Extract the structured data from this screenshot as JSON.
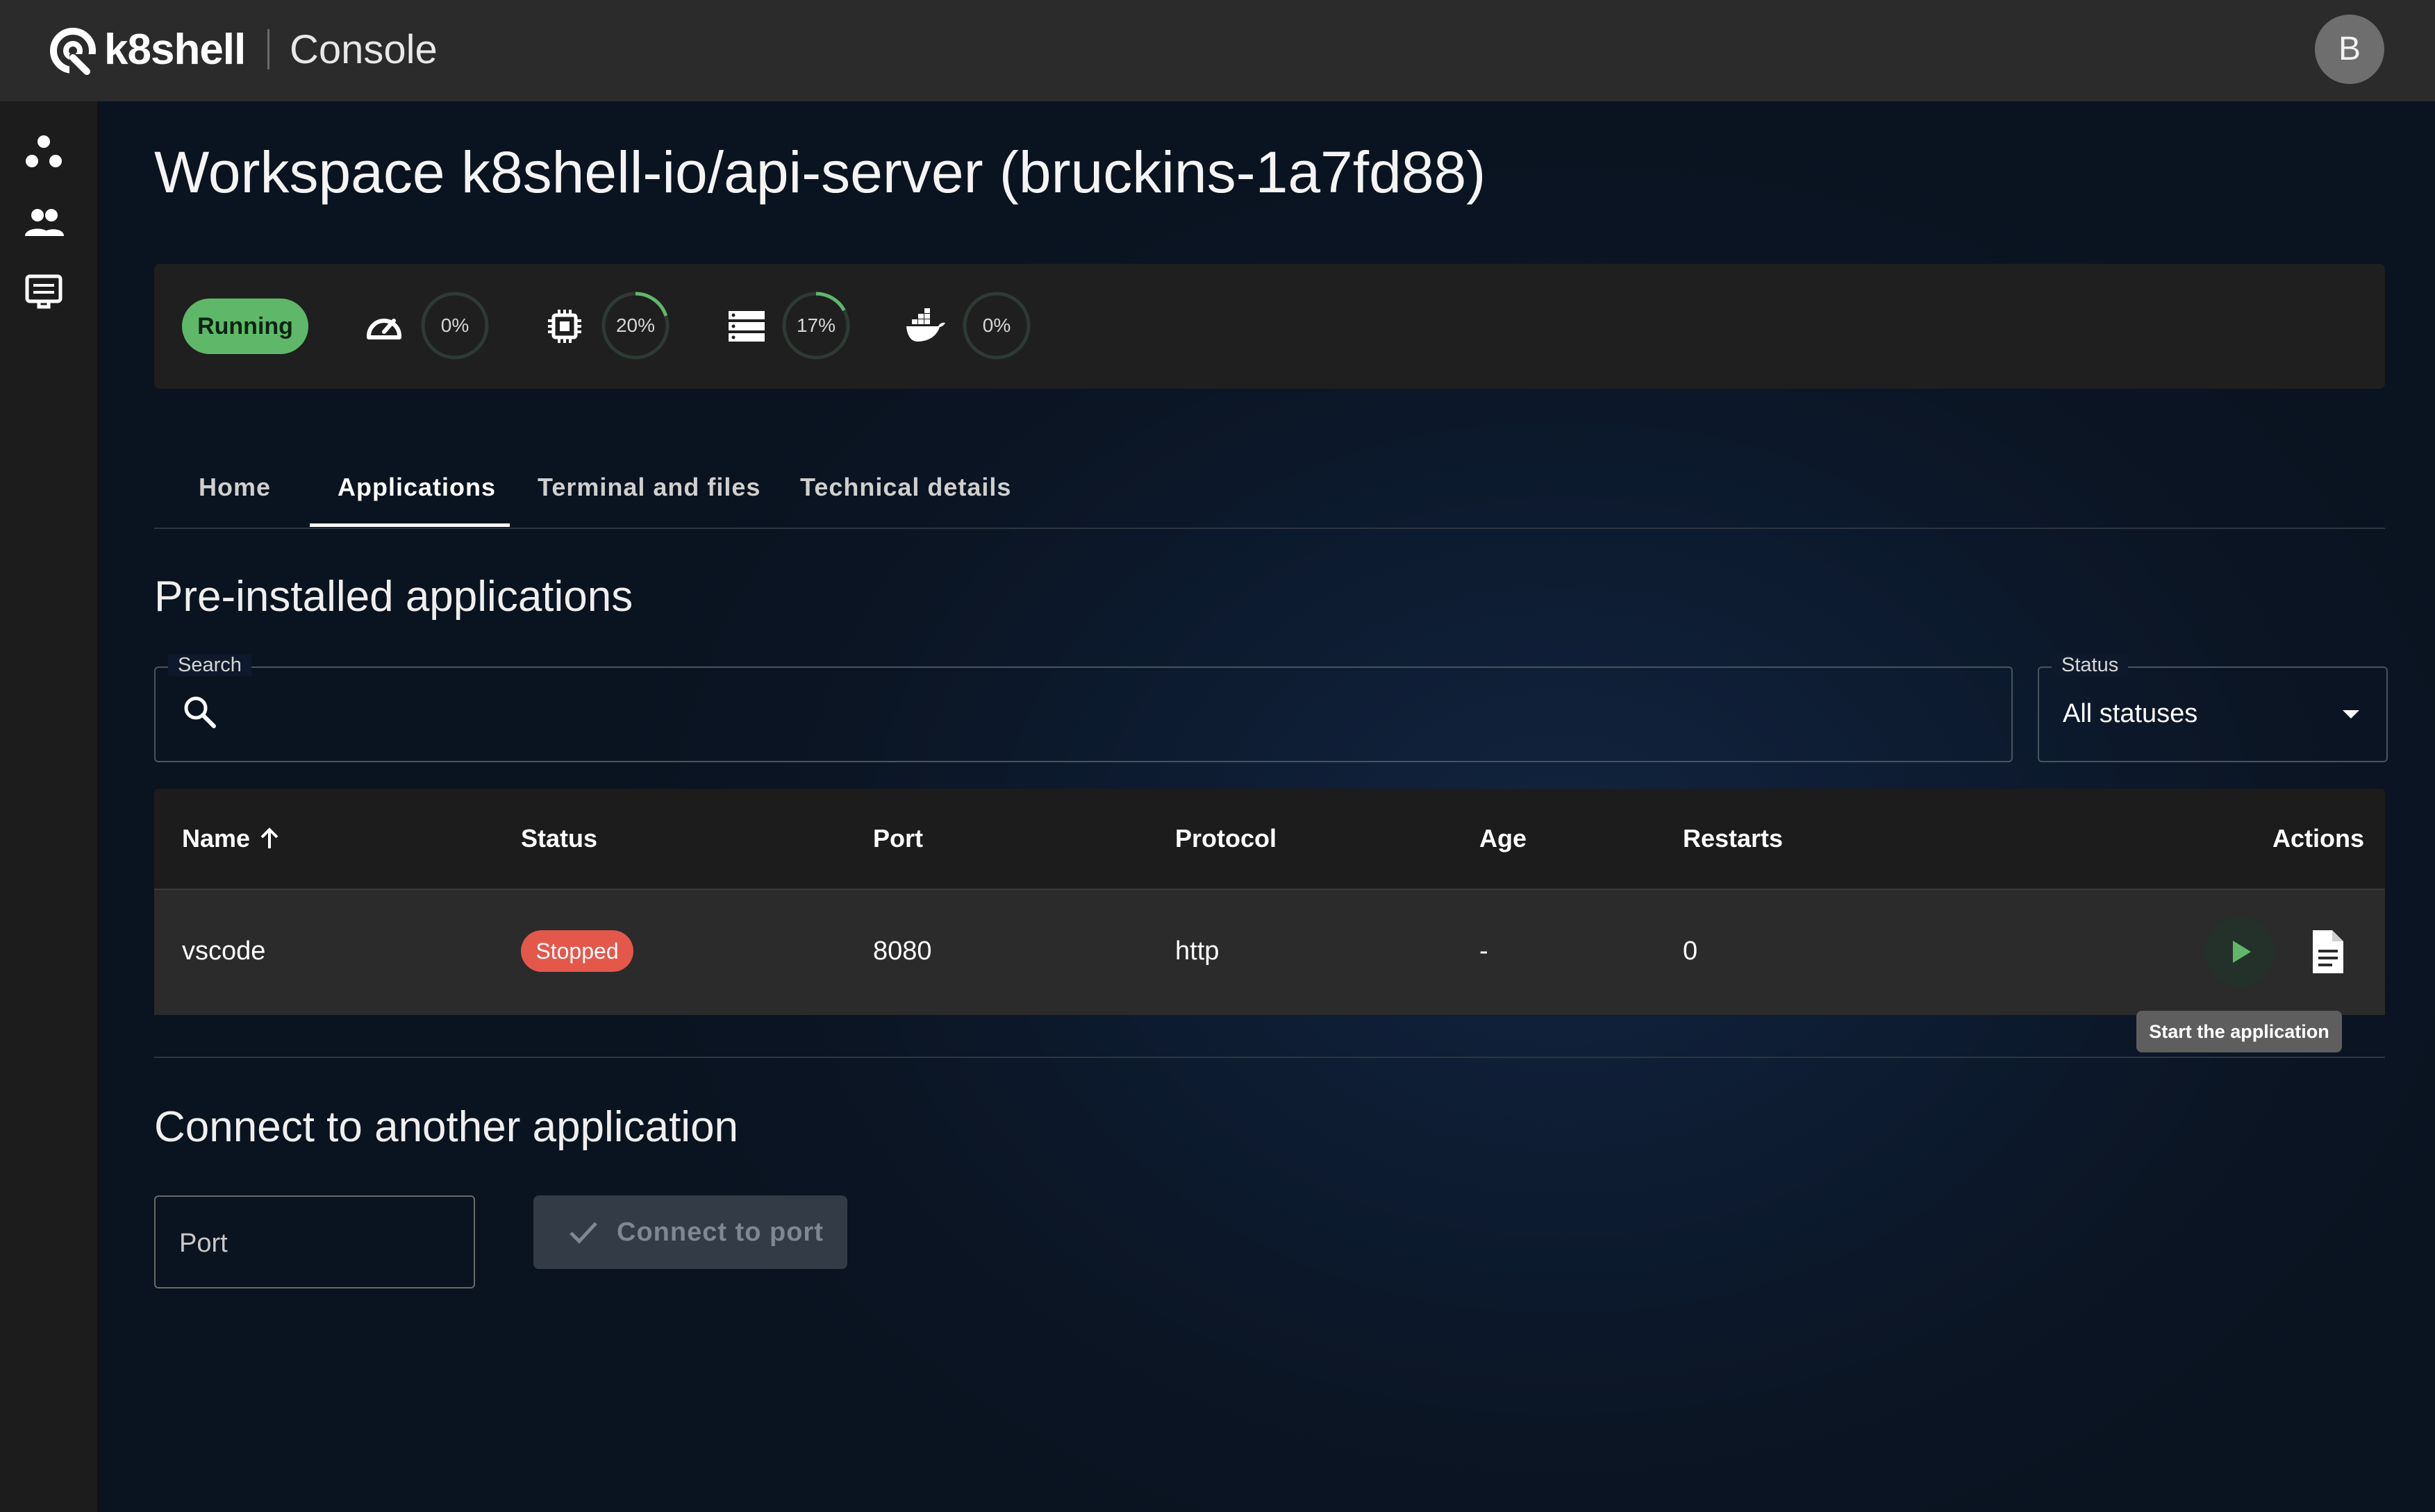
{
  "app": {
    "brand": "k8shell",
    "name": "Console",
    "avatar_initial": "B"
  },
  "page": {
    "title": "Workspace k8shell-io/api-server (bruckins-1a7fd88)"
  },
  "workspace_status": "Running",
  "metrics": [
    {
      "icon": "speedometer-icon",
      "value": 0,
      "label": "0%"
    },
    {
      "icon": "cpu-icon",
      "value": 20,
      "label": "20%"
    },
    {
      "icon": "storage-icon",
      "value": 17,
      "label": "17%"
    },
    {
      "icon": "docker-icon",
      "value": 0,
      "label": "0%"
    }
  ],
  "tabs": [
    {
      "label": "Home",
      "active": false
    },
    {
      "label": "Applications",
      "active": true
    },
    {
      "label": "Terminal and files",
      "active": false
    },
    {
      "label": "Technical details",
      "active": false
    }
  ],
  "preinstalled": {
    "title": "Pre-installed applications",
    "search": {
      "label": "Search",
      "value": ""
    },
    "status_filter": {
      "label": "Status",
      "value": "All statuses"
    },
    "columns": [
      "Name",
      "Status",
      "Port",
      "Protocol",
      "Age",
      "Restarts",
      "Actions"
    ],
    "rows": [
      {
        "name": "vscode",
        "status": "Stopped",
        "port": "8080",
        "protocol": "http",
        "age": "-",
        "restarts": "0"
      }
    ],
    "tooltip": "Start the application"
  },
  "connect": {
    "title": "Connect to another application",
    "port_placeholder": "Port",
    "button_label": "Connect to port"
  },
  "colors": {
    "topbar": "#2b2b2b",
    "running": "#5fb86a",
    "stopped": "#e4574b",
    "gauge_arc": "#5fb86a",
    "background": "#0b1524"
  }
}
